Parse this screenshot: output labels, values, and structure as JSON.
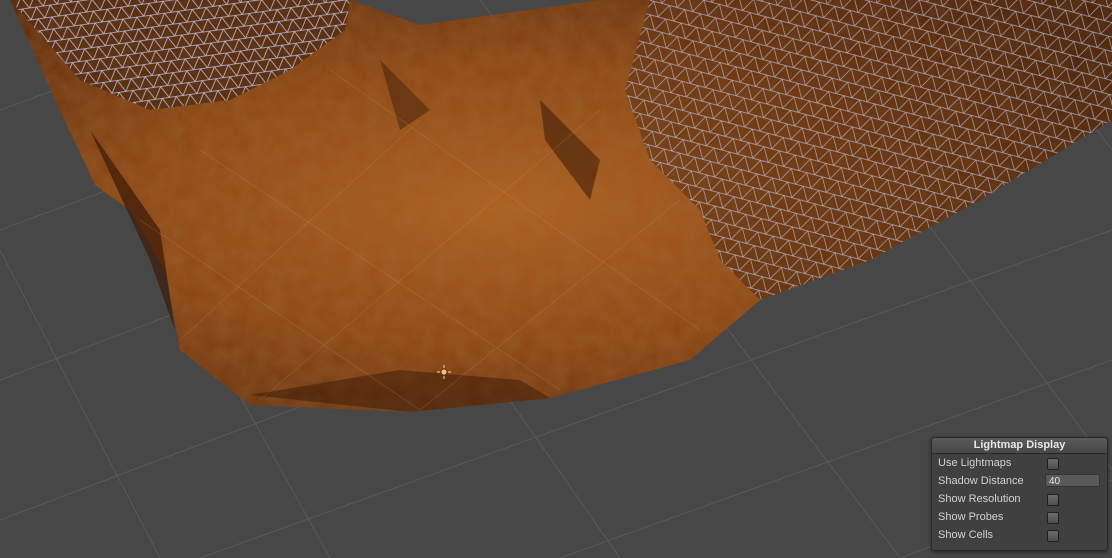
{
  "lightmap_display": {
    "title": "Lightmap Display",
    "use_lightmaps": {
      "label": "Use Lightmaps",
      "checked": false
    },
    "shadow_distance": {
      "label": "Shadow Distance",
      "value": "40"
    },
    "show_resolution": {
      "label": "Show Resolution",
      "checked": false
    },
    "show_probes": {
      "label": "Show Probes",
      "checked": false
    },
    "show_cells": {
      "label": "Show Cells",
      "checked": false
    }
  },
  "scene": {
    "background_color": "#474747",
    "grid_color": "#5a5a5a",
    "terrain_color": "#9a4d16",
    "wireframe_color": "#c9d7ff",
    "icons": [
      "point-light-icon"
    ]
  }
}
